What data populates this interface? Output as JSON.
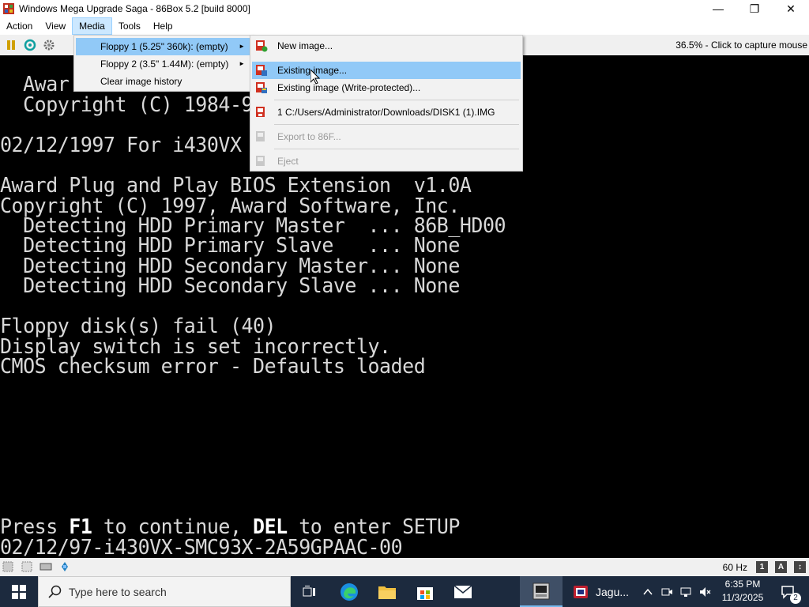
{
  "window": {
    "title": "Windows Mega Upgrade Saga - 86Box 5.2 [build 8000]",
    "minimize_glyph": "—",
    "maximize_glyph": "❐",
    "close_glyph": "✕"
  },
  "menubar": {
    "items": [
      "Action",
      "View",
      "Media",
      "Tools",
      "Help"
    ]
  },
  "toolbar": {
    "status": "36.5% - Click to capture mouse"
  },
  "media_menu": {
    "items": [
      {
        "label": "Floppy 1 (5.25\" 360k): (empty)",
        "arrow": "►"
      },
      {
        "label": "Floppy 2 (3.5\" 1.44M): (empty)",
        "arrow": "►"
      },
      {
        "label": "Clear image history"
      }
    ]
  },
  "floppy_submenu": {
    "items": [
      {
        "label": "New image...",
        "icon": "new-image-icon"
      },
      {
        "label": "Existing image...",
        "icon": "existing-image-icon"
      },
      {
        "label": "Existing image (Write-protected)...",
        "icon": "existing-image-wp-icon"
      },
      {
        "label": "1 C:/Users/Administrator/Downloads/DISK1 (1).IMG",
        "icon": "recent-image-icon"
      },
      {
        "label": "Export to 86F...",
        "icon": "export-icon"
      },
      {
        "label": "Eject",
        "icon": "eject-icon"
      }
    ]
  },
  "bios": {
    "lines": [
      "  Awar",
      "  Copyright (C) 1984-97,",
      "02/12/1997 For i430VX PCI",
      "Award Plug and Play BIOS Extension  v1.0A",
      "Copyright (C) 1997, Award Software, Inc.",
      "  Detecting HDD Primary Master  ... 86B_HD00",
      "  Detecting HDD Primary Slave   ... None",
      "  Detecting HDD Secondary Master... None",
      "  Detecting HDD Secondary Slave ... None",
      "Floppy disk(s) fail (40)",
      "Display switch is set incorrectly.",
      "CMOS checksum error - Defaults loaded",
      "02/12/97-i430VX-SMC93X-2A59GPAAC-00"
    ],
    "press_line": {
      "a": "Press ",
      "b": "F1",
      "c": " to continue, ",
      "d": "DEL",
      "e": " to enter SETUP"
    }
  },
  "statusbar": {
    "refresh": "60 Hz",
    "locks": [
      "1",
      "A",
      "↕"
    ]
  },
  "taskbar": {
    "search_placeholder": "Type here to search",
    "jaguar_label": "Jagu...",
    "clock_time": "6:35 PM",
    "clock_date": "11/3/2025",
    "notification_count": "2"
  },
  "colors": {
    "menu_highlight": "#91c9f7",
    "menubar_active": "#cce8ff",
    "taskbar_bg": "#1c2a3e",
    "bios_text": "#d8d8d8"
  }
}
